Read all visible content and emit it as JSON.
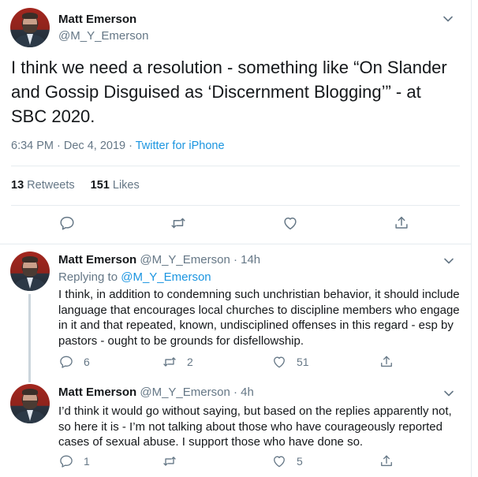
{
  "main_tweet": {
    "author_name": "Matt Emerson",
    "author_handle": "@M_Y_Emerson",
    "text": "I think we need a resolution - something like “On Slander and Gossip Disguised as ‘Discernment Blogging’” - at SBC 2020.",
    "timestamp": "6:34 PM · Dec 4, 2019 · ",
    "source": "Twitter for iPhone",
    "retweets_count": "13",
    "retweets_label": " Retweets",
    "likes_count": "151",
    "likes_label": " Likes",
    "icons": [
      "reply-icon",
      "retweet-icon",
      "like-icon",
      "share-icon"
    ]
  },
  "replies": [
    {
      "author_name": "Matt Emerson",
      "author_handle": "@M_Y_Emerson",
      "time": " · 14h",
      "replying_label": "Replying to ",
      "replying_to": "@M_Y_Emerson",
      "text": "I think, in addition to condemning such unchristian behavior, it should include language that encourages local churches to discipline members who engage in it and that repeated, known, undisciplined offenses in this regard - esp by pastors - ought to be grounds for disfellowship.",
      "reply_count": "6",
      "retweet_count": "2",
      "like_count": "51"
    },
    {
      "author_name": "Matt Emerson",
      "author_handle": "@M_Y_Emerson",
      "time": " · 4h",
      "text": "I’d think it would go without saying, but based on the replies apparently not, so here it is - I’m not talking about those who have courageously reported cases of sexual abuse. I support those who have done so.",
      "reply_count": "1",
      "retweet_count": "",
      "like_count": "5"
    }
  ],
  "colors": {
    "text": "#14171a",
    "secondary": "#657786",
    "link": "#1b95e0",
    "border": "#e6ecf0",
    "thread_line": "#ccd6dd"
  }
}
